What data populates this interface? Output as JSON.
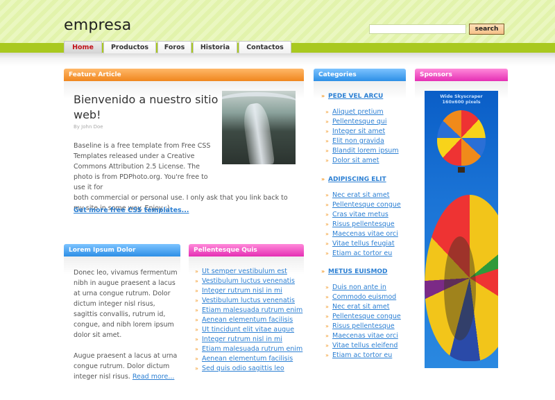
{
  "site": {
    "logo": "empresa"
  },
  "search": {
    "button_label": "search",
    "placeholder": ""
  },
  "nav": {
    "tabs": [
      {
        "label": "Home",
        "active": true
      },
      {
        "label": "Productos",
        "active": false
      },
      {
        "label": "Foros",
        "active": false
      },
      {
        "label": "Historia",
        "active": false
      },
      {
        "label": "Contactos",
        "active": false
      }
    ]
  },
  "feature": {
    "heading": "Feature Article",
    "title": "Bienvenido a nuestro sitio web!",
    "author": "By John Doe",
    "body_narrow": "Baseline is a free template from Free CSS Templates released under a Creative Commons Attribution 2.5 License. The photo is from PDPhoto.org. You're free to use it for",
    "body_wide": "both commercial or personal use. I only ask that you link back to my site in some way. Enjoy :)",
    "link": "Get more free CSS templates..."
  },
  "lorem_box": {
    "heading": "Lorem Ipsum Dolor",
    "paragraph1": "Donec leo, vivamus fermentum nibh in augue praesent a lacus at urna congue rutrum. Dolor dictum integer nisl risus, sagittis convallis, rutrum id, congue, and nibh lorem ipsum dolor sit amet.",
    "paragraph2": "Augue praesent a lacus at urna congue rutrum. Dolor dictum integer nisl risus.",
    "read_more": "Read more..."
  },
  "pellentesque_box": {
    "heading": "Pellentesque Quis",
    "links": [
      "Ut semper vestibulum est",
      "Vestibulum luctus venenatis",
      "Integer rutrum nisl in mi",
      "Vestibulum luctus venenatis",
      "Etiam malesuada rutrum enim",
      "Aenean elementum facilisis",
      "Ut tincidunt elit vitae augue",
      "Integer rutrum nisl in mi",
      "Etiam malesuada rutrum enim",
      "Aenean elementum facilisis",
      "Sed quis odio sagittis leo"
    ]
  },
  "categories": {
    "heading": "Categories",
    "groups": [
      {
        "title": "PEDE VEL ARCU",
        "links": [
          "Aliquet pretium",
          "Pellentesque qui",
          "Integer sit amet",
          "Elit non gravida",
          "Blandit lorem ipsum",
          "Dolor sit amet"
        ]
      },
      {
        "title": "ADIPISCING ELIT",
        "links": [
          "Nec erat sit amet",
          "Pellentesque congue",
          "Cras vitae metus",
          "Risus pellentesque",
          "Maecenas vitae orci",
          "Vitae tellus feugiat",
          "Etiam ac tortor eu"
        ]
      },
      {
        "title": "METUS EUISMOD",
        "links": [
          "Duis non ante in",
          "Commodo euismod",
          "Nec erat sit amet",
          "Pellentesque congue",
          "Risus pellentesque",
          "Maecenas vitae orci",
          "Vitae tellus eleifend",
          "Etiam ac tortor eu"
        ]
      }
    ]
  },
  "sponsors": {
    "heading": "Sponsors",
    "ad_line1": "Wide Skyscraper",
    "ad_line2": "160x600 pixels"
  }
}
